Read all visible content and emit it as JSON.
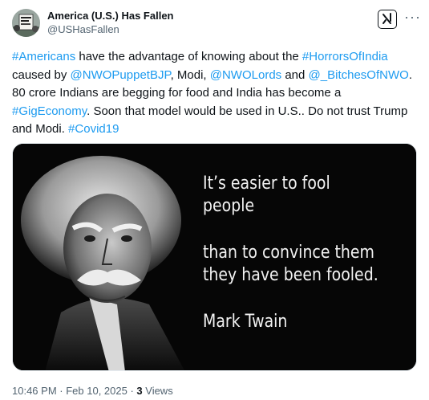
{
  "author": {
    "display_name": "America (U.S.) Has Fallen",
    "handle": "@USHasFallen"
  },
  "icons": {
    "grok": "grok-icon",
    "more": "more-icon",
    "avatar": "avatar-protest-sign"
  },
  "post": {
    "segments": [
      {
        "text": "#Americans",
        "link": true
      },
      {
        "text": " have the advantage of knowing about the ",
        "link": false
      },
      {
        "text": "#HorrorsOfIndia",
        "link": true
      },
      {
        "text": " caused by ",
        "link": false
      },
      {
        "text": "@NWOPuppetBJP",
        "link": true
      },
      {
        "text": ", Modi, ",
        "link": false
      },
      {
        "text": "@NWOLords",
        "link": true
      },
      {
        "text": " and ",
        "link": false
      },
      {
        "text": "@_BitchesOfNWO",
        "link": true
      },
      {
        "text": ". 80 crore Indians are begging for food and India has become a ",
        "link": false
      },
      {
        "text": "#GigEconomy",
        "link": true
      },
      {
        "text": ". Soon that model would be used in U.S.. Do not trust Trump and Modi. ",
        "link": false
      },
      {
        "text": "#Covid19",
        "link": true
      }
    ]
  },
  "media": {
    "quote_line1": "It’s easier to fool",
    "quote_line2": "people",
    "quote_line3": "than to convince them",
    "quote_line4": "they have been fooled.",
    "attribution": "Mark Twain"
  },
  "meta": {
    "time": "10:46 PM",
    "separator1": " · ",
    "date": "Feb 10, 2025",
    "separator2": " · ",
    "views_count": "3",
    "views_label": " Views"
  },
  "colors": {
    "link": "#1d9bf0",
    "text": "#0f1419",
    "secondary": "#536471"
  }
}
